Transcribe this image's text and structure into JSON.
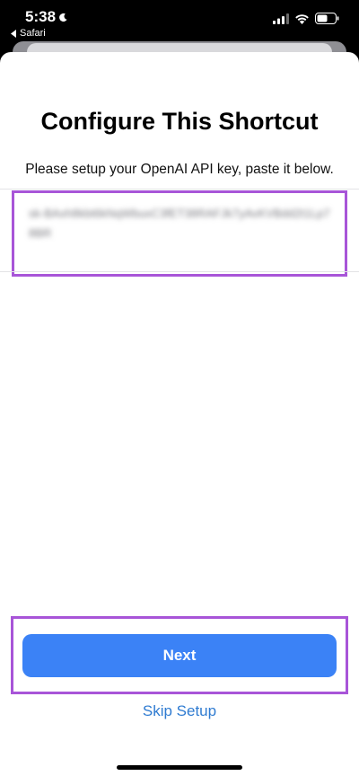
{
  "status_bar": {
    "time": "5:38",
    "back_app": "Safari",
    "icons": [
      "moon-icon",
      "signal-icon",
      "wifi-icon",
      "battery-icon"
    ]
  },
  "sheet": {
    "title": "Configure This Shortcut",
    "subtitle": "Please setup your OpenAI API key, paste it below.",
    "api_key_value": "sk-BAxh8kbt6kNqWbuxC3fET38RAFJk7yAvKVBdd2t1Lp78BR",
    "next_label": "Next",
    "skip_label": "Skip Setup"
  },
  "colors": {
    "accent_button": "#3b82f6",
    "link": "#2f7bd1",
    "highlight_border": "#a855d8"
  }
}
